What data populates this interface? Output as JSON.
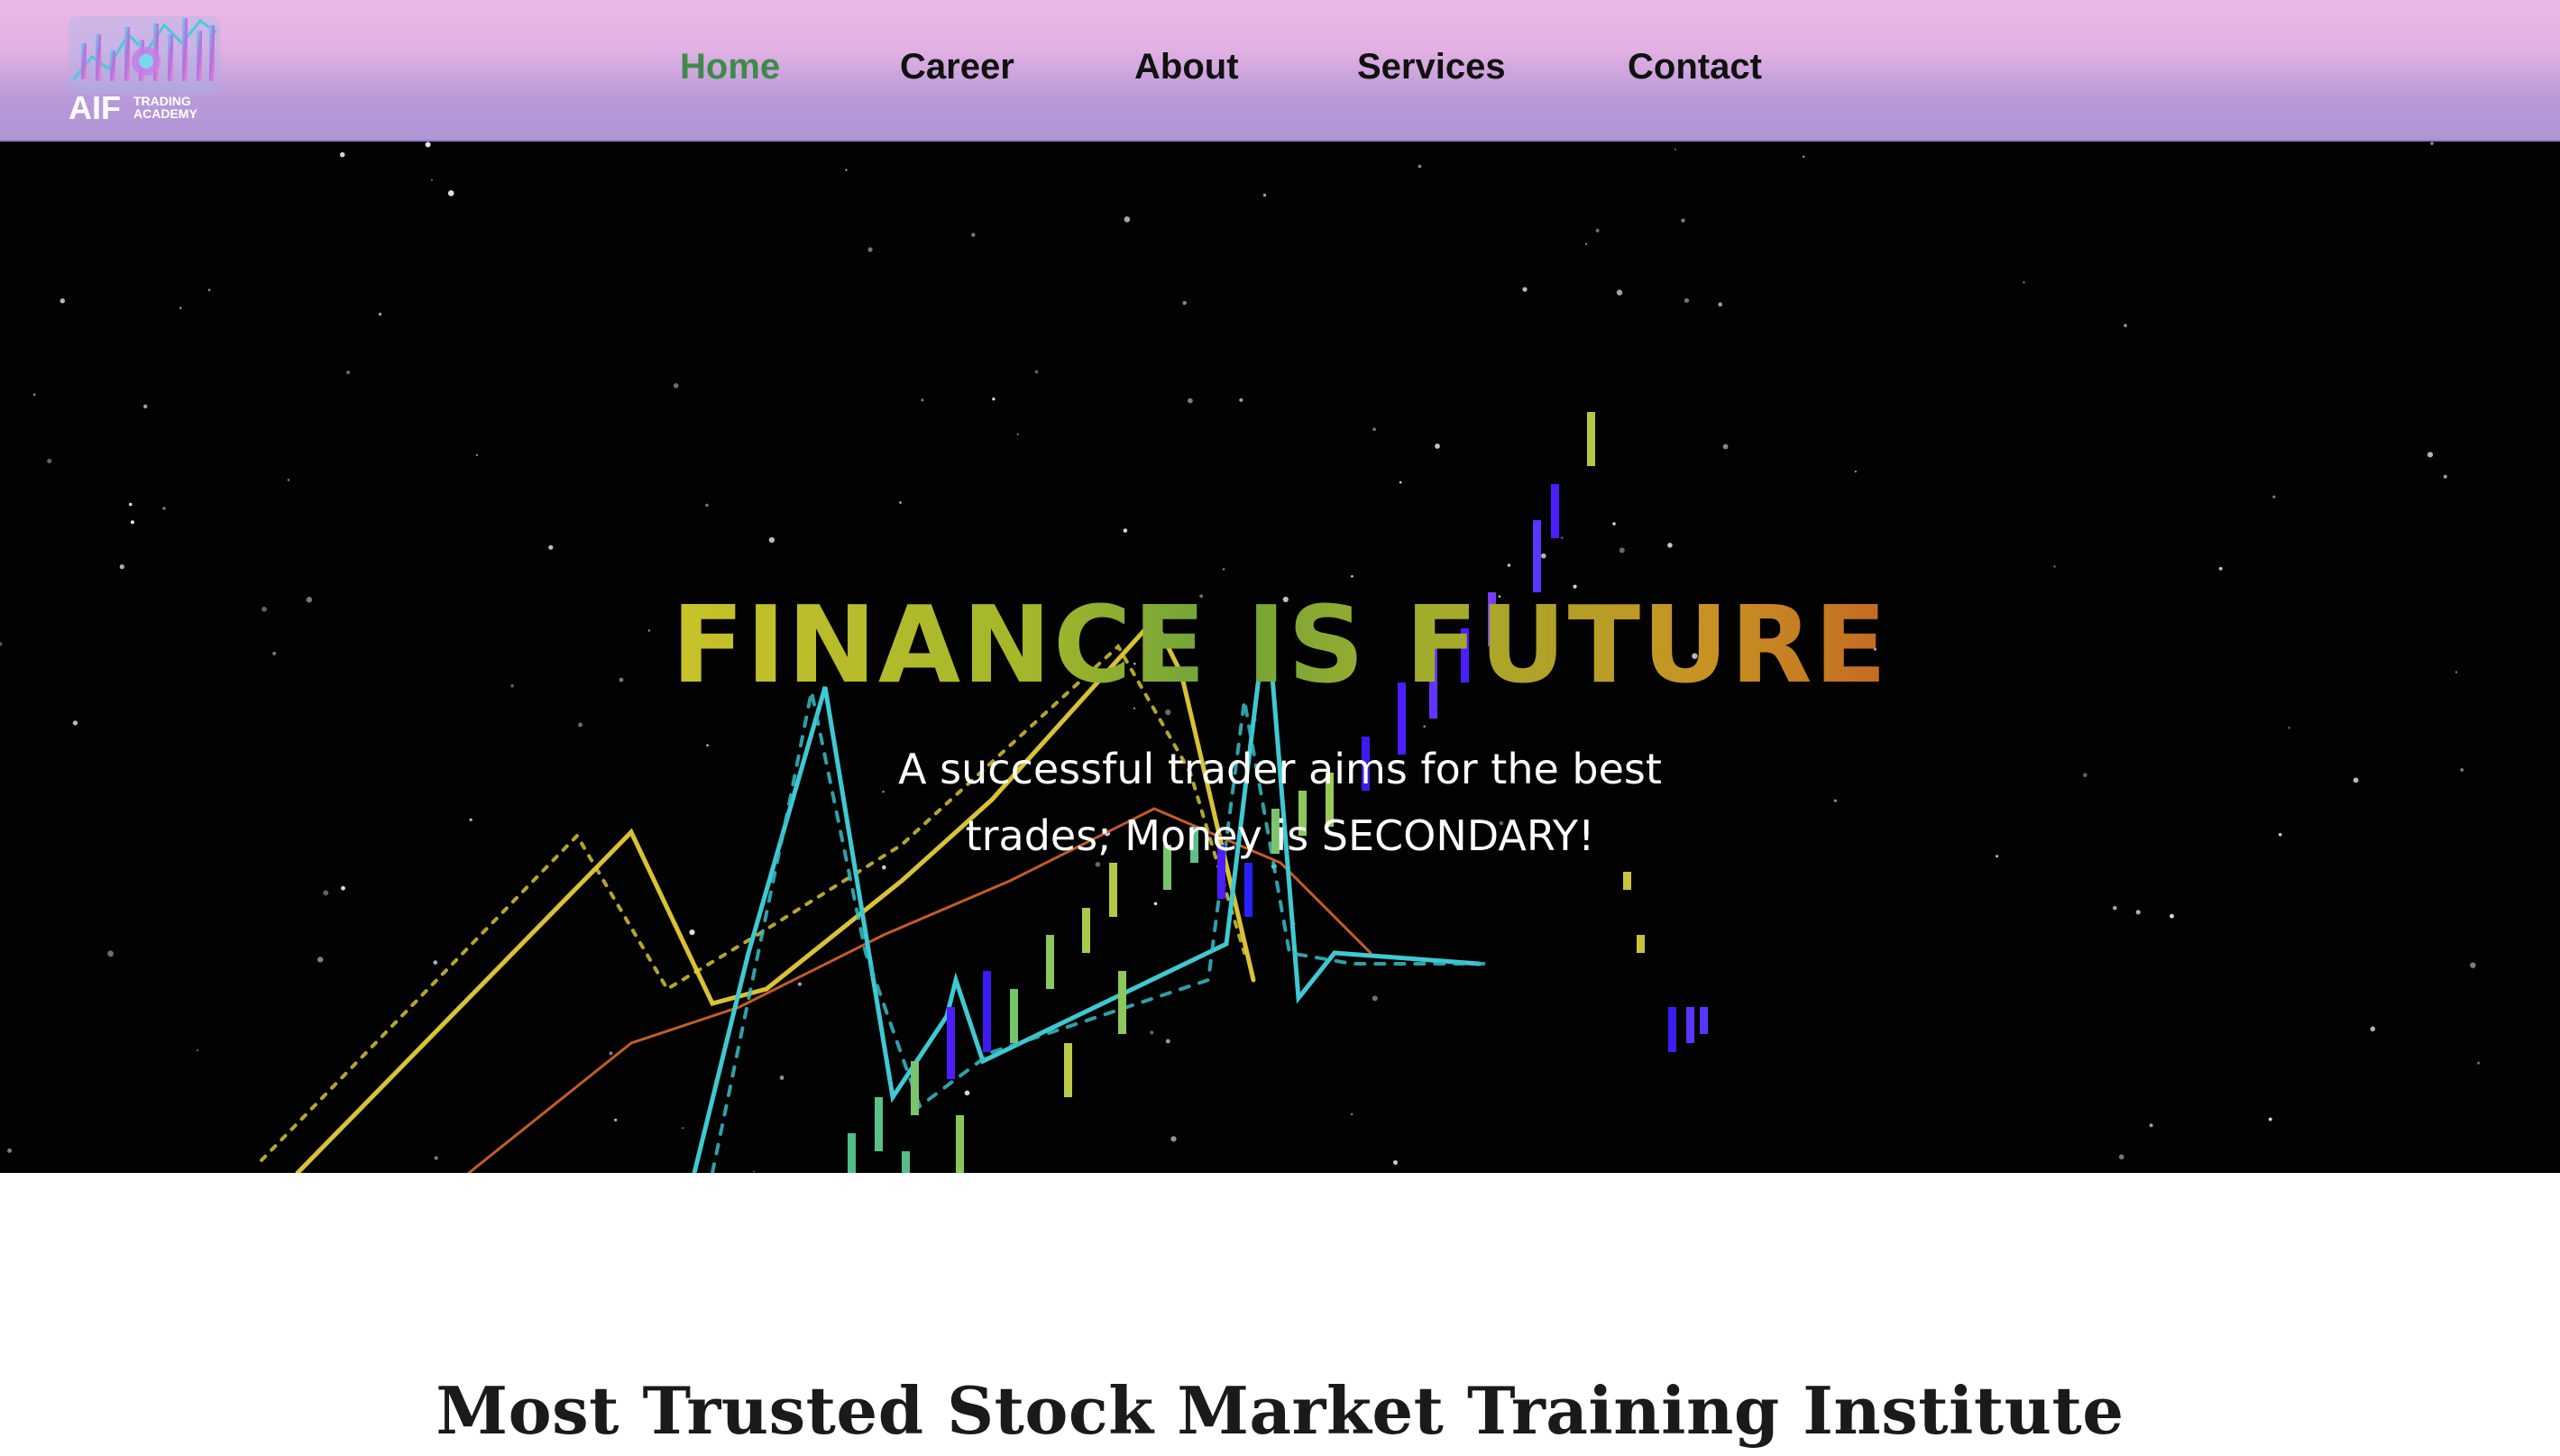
{
  "brand": {
    "logo_text": "AIF",
    "logo_subtext_1": "TRADING",
    "logo_subtext_2": "ACADEMY"
  },
  "nav": {
    "items": [
      {
        "label": "Home",
        "active": true
      },
      {
        "label": "Career",
        "active": false
      },
      {
        "label": "About",
        "active": false
      },
      {
        "label": "Services",
        "active": false
      },
      {
        "label": "Contact",
        "active": false
      }
    ]
  },
  "hero": {
    "title": "FINANCE IS FUTURE",
    "subtitle_line_1": "A successful trader aims for the best",
    "subtitle_line_2": "trades; Money is SECONDARY!"
  },
  "section": {
    "title": "Most Trusted Stock Market Training Institute"
  },
  "colors": {
    "nav_gradient_top": "#ecb8e6",
    "nav_gradient_bottom": "#ae95d6",
    "nav_active": "#3f8a4a",
    "hero_background": "#020203",
    "title_gradient_start": "#c8c22a",
    "title_gradient_end": "#c46a22"
  }
}
